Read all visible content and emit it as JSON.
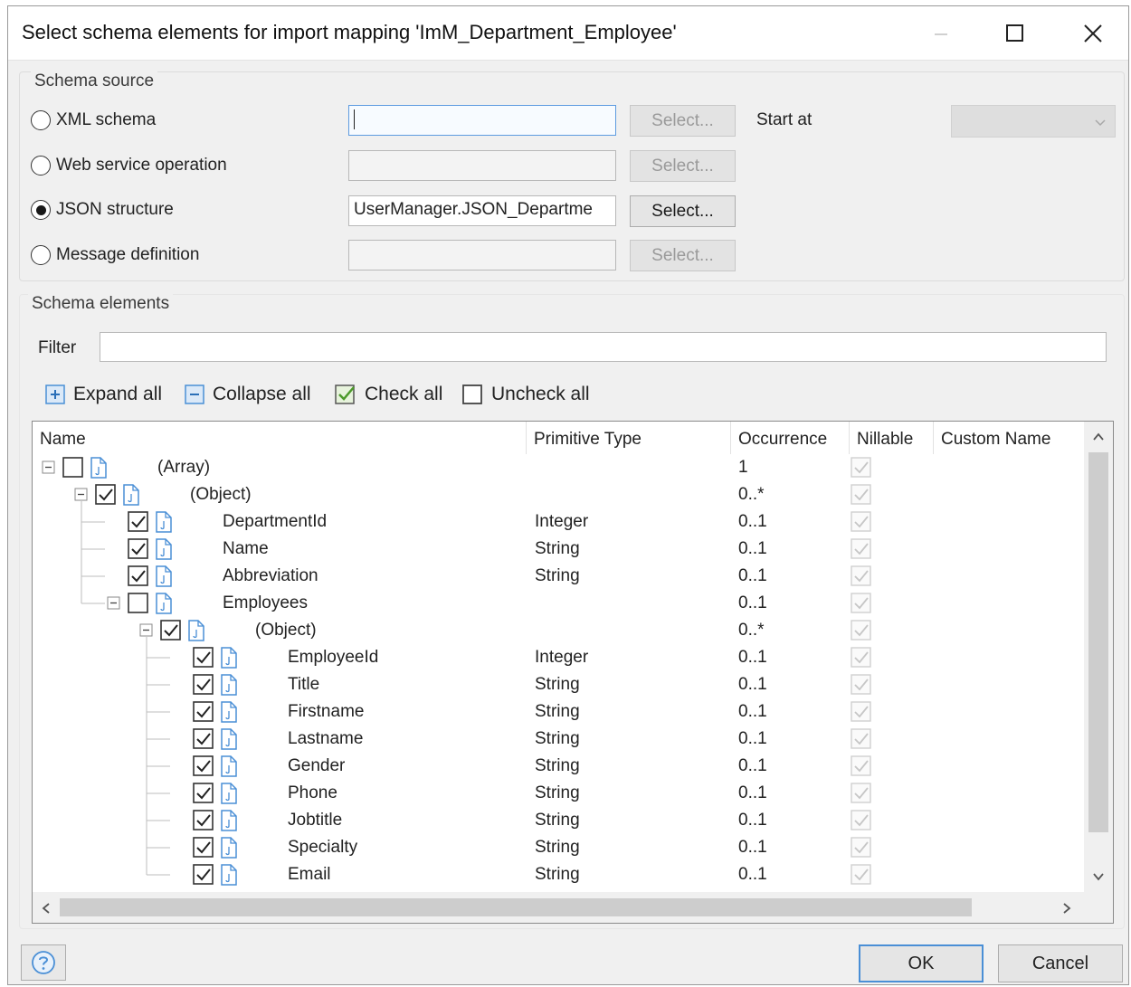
{
  "window": {
    "title": "Select schema elements for import mapping 'ImM_Department_Employee'"
  },
  "schema_source": {
    "group_title": "Schema source",
    "options": [
      {
        "label": "XML schema",
        "selected": false,
        "value": "",
        "button": "Select...",
        "button_enabled": false
      },
      {
        "label": "Web service operation",
        "selected": false,
        "value": "",
        "button": "Select...",
        "button_enabled": false
      },
      {
        "label": "JSON structure",
        "selected": true,
        "value": "UserManager.JSON_Departme",
        "button": "Select...",
        "button_enabled": true
      },
      {
        "label": "Message definition",
        "selected": false,
        "value": "",
        "button": "Select...",
        "button_enabled": false
      }
    ],
    "start_at_label": "Start at",
    "start_at_value": ""
  },
  "schema_elements": {
    "group_title": "Schema elements",
    "filter_label": "Filter",
    "filter_value": "",
    "toolbar": {
      "expand_all": "Expand all",
      "collapse_all": "Collapse all",
      "check_all": "Check all",
      "uncheck_all": "Uncheck all"
    },
    "columns": {
      "name": "Name",
      "primitive_type": "Primitive Type",
      "occurrence": "Occurrence",
      "nillable": "Nillable",
      "custom_name": "Custom Name"
    },
    "rows": [
      {
        "name": "(Array)",
        "type": "",
        "occurrence": "1",
        "checked": false,
        "depth": 0,
        "expandable": true
      },
      {
        "name": "(Object)",
        "type": "",
        "occurrence": "0..*",
        "checked": true,
        "depth": 1,
        "expandable": true
      },
      {
        "name": "DepartmentId",
        "type": "Integer",
        "occurrence": "0..1",
        "checked": true,
        "depth": 2,
        "expandable": false
      },
      {
        "name": "Name",
        "type": "String",
        "occurrence": "0..1",
        "checked": true,
        "depth": 2,
        "expandable": false
      },
      {
        "name": "Abbreviation",
        "type": "String",
        "occurrence": "0..1",
        "checked": true,
        "depth": 2,
        "expandable": false
      },
      {
        "name": "Employees",
        "type": "",
        "occurrence": "0..1",
        "checked": false,
        "depth": 2,
        "expandable": true
      },
      {
        "name": "(Object)",
        "type": "",
        "occurrence": "0..*",
        "checked": true,
        "depth": 3,
        "expandable": true
      },
      {
        "name": "EmployeeId",
        "type": "Integer",
        "occurrence": "0..1",
        "checked": true,
        "depth": 4,
        "expandable": false
      },
      {
        "name": "Title",
        "type": "String",
        "occurrence": "0..1",
        "checked": true,
        "depth": 4,
        "expandable": false
      },
      {
        "name": "Firstname",
        "type": "String",
        "occurrence": "0..1",
        "checked": true,
        "depth": 4,
        "expandable": false
      },
      {
        "name": "Lastname",
        "type": "String",
        "occurrence": "0..1",
        "checked": true,
        "depth": 4,
        "expandable": false
      },
      {
        "name": "Gender",
        "type": "String",
        "occurrence": "0..1",
        "checked": true,
        "depth": 4,
        "expandable": false
      },
      {
        "name": "Phone",
        "type": "String",
        "occurrence": "0..1",
        "checked": true,
        "depth": 4,
        "expandable": false
      },
      {
        "name": "Jobtitle",
        "type": "String",
        "occurrence": "0..1",
        "checked": true,
        "depth": 4,
        "expandable": false
      },
      {
        "name": "Specialty",
        "type": "String",
        "occurrence": "0..1",
        "checked": true,
        "depth": 4,
        "expandable": false
      },
      {
        "name": "Email",
        "type": "String",
        "occurrence": "0..1",
        "checked": true,
        "depth": 4,
        "expandable": false
      }
    ]
  },
  "footer": {
    "ok": "OK",
    "cancel": "Cancel"
  },
  "icons": {
    "minimize": "minimize-icon",
    "maximize": "maximize-icon",
    "close": "close-icon",
    "help": "help-icon",
    "document": "document-icon",
    "accent": "#4a8fd6"
  }
}
